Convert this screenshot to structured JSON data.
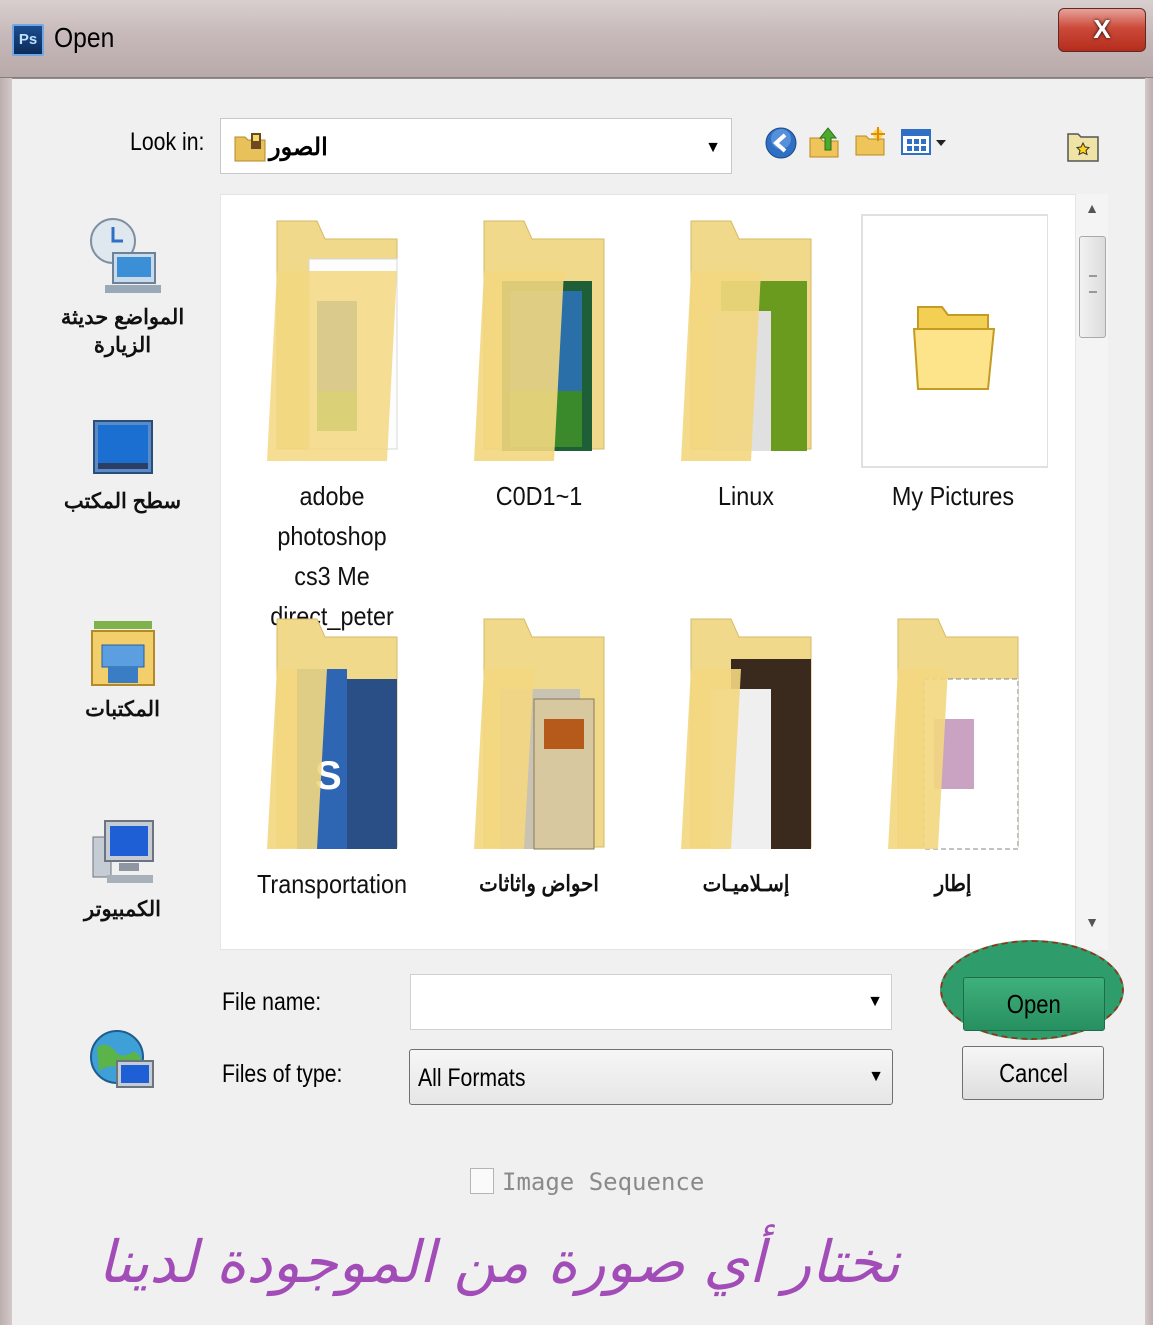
{
  "window": {
    "app_icon": "Ps",
    "title": "Open",
    "close_label": "X"
  },
  "look_in": {
    "label": "Look in:",
    "value": "الصور"
  },
  "toolbar": {
    "icons": [
      "back-icon",
      "up-folder-icon",
      "new-folder-icon",
      "view-menu-icon"
    ],
    "extra_icon": "folder-star-icon"
  },
  "places": [
    {
      "label_line1": "المواضع حديثة",
      "label_line2": "الزيارة",
      "icon": "recent-places-icon"
    },
    {
      "label_line1": "سطح المكتب",
      "label_line2": "",
      "icon": "desktop-icon"
    },
    {
      "label_line1": "المكتبات",
      "label_line2": "",
      "icon": "libraries-icon"
    },
    {
      "label_line1": "الكمبيوتر",
      "label_line2": "",
      "icon": "computer-icon"
    },
    {
      "label_line1": "",
      "label_line2": "",
      "icon": "network-icon"
    }
  ],
  "files": [
    {
      "line1": "adobe photoshop",
      "line2": "cs3 Me",
      "line3": "direct_peter"
    },
    {
      "line1": "C0D1~1",
      "line2": "",
      "line3": ""
    },
    {
      "line1": "Linux",
      "line2": "",
      "line3": ""
    },
    {
      "line1": "My Pictures",
      "line2": "",
      "line3": ""
    },
    {
      "line1": "Transportation",
      "line2": "",
      "line3": ""
    },
    {
      "line1": "احواض واثاثات",
      "line2": "",
      "line3": ""
    },
    {
      "line1": "إسـلاميـات",
      "line2": "",
      "line3": ""
    },
    {
      "line1": "إطار",
      "line2": "",
      "line3": ""
    }
  ],
  "form": {
    "file_name_label": "File name:",
    "file_name_value": "",
    "file_type_label": "Files of type:",
    "file_type_value": "All Formats",
    "open_label": "Open",
    "cancel_label": "Cancel",
    "image_sequence_label": "Image Sequence"
  },
  "caption": "نختار أي صورة من الموجودة لدينا",
  "colors": {
    "open_highlight": "#2f9d6b",
    "caption": "#a24cb8",
    "close_button": "#cc4a3a"
  }
}
